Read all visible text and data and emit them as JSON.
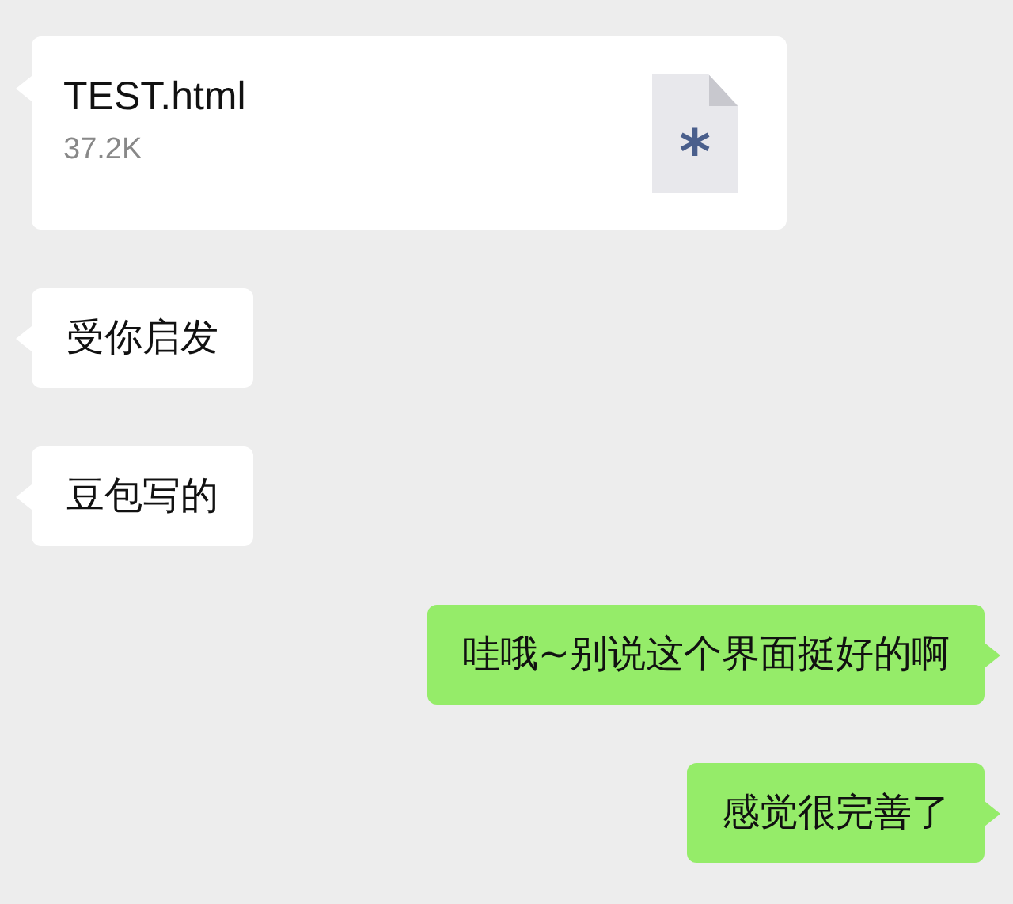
{
  "messages": [
    {
      "kind": "file",
      "outgoing": false,
      "file_name": "TEST.html",
      "file_size": "37.2K",
      "file_icon_symbol": "*"
    },
    {
      "kind": "text",
      "outgoing": false,
      "text": "受你启发"
    },
    {
      "kind": "text",
      "outgoing": false,
      "text": "豆包写的"
    },
    {
      "kind": "text",
      "outgoing": true,
      "text": "哇哦~别说这个界面挺好的啊"
    },
    {
      "kind": "text",
      "outgoing": true,
      "text": "感觉很完善了"
    }
  ]
}
